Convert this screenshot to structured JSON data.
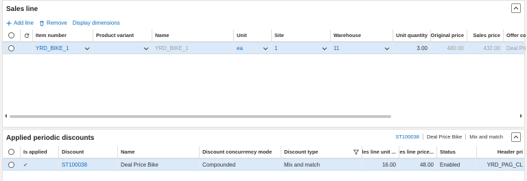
{
  "sales_line": {
    "title": "Sales line",
    "toolbar": {
      "add_line": "Add line",
      "remove": "Remove",
      "display_dimensions": "Display dimensions"
    },
    "columns": [
      "Item number",
      "Product variant",
      "Name",
      "Unit",
      "Site",
      "Warehouse",
      "Unit quantity",
      "Original price",
      "Sales price",
      "Offer co"
    ],
    "row": {
      "item_number": "YRD_BIKE_1",
      "product_variant": "",
      "name": "YRD_BIKE_1",
      "unit": "ea",
      "site": "1",
      "warehouse": "11",
      "unit_quantity": "3.00",
      "original_price": "480.00",
      "sales_price": "432.00",
      "offer_code": "Deal Price"
    }
  },
  "applied_discounts": {
    "title": "Applied periodic discounts",
    "tags": [
      "ST100038",
      "Deal Price Bike",
      "Mix and match"
    ],
    "columns": [
      "Is applied",
      "Discount",
      "Name",
      "Discount concurrency mode",
      "Discount type",
      "Sales line unit ...",
      "Sales line price...",
      "Status",
      "Header pri"
    ],
    "row": {
      "is_applied": "✓",
      "discount": "ST100038",
      "name": "Deal Price Bike",
      "concurrency_mode": "Compounded",
      "discount_type": "Mix and match",
      "sales_line_unit": "16.00",
      "sales_line_price": "48.00",
      "status": "Enabled",
      "header_price": "YRD_PAG_CL"
    }
  },
  "colors": {
    "accent": "#0f6cbd",
    "selected_row": "#dce9f8"
  }
}
